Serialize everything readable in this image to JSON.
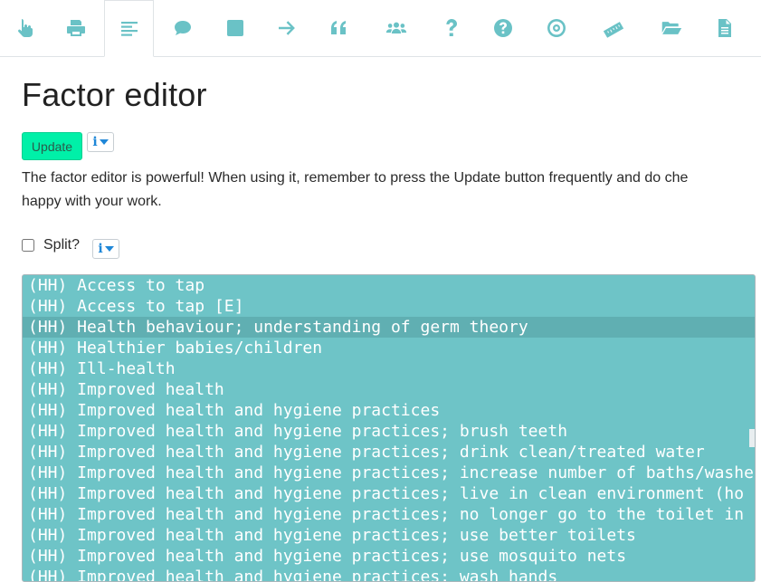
{
  "toolbar": {
    "items": [
      {
        "name": "hand-pointer-icon"
      },
      {
        "name": "print-icon"
      },
      {
        "name": "align-left-icon",
        "active": true
      },
      {
        "name": "comment-icon"
      },
      {
        "name": "square-icon"
      },
      {
        "name": "arrow-right-icon"
      },
      {
        "name": "quote-icon"
      },
      {
        "name": "users-icon"
      },
      {
        "name": "question-icon"
      },
      {
        "name": "question-circle-icon"
      },
      {
        "name": "bullseye-icon"
      },
      {
        "name": "ruler-icon"
      },
      {
        "name": "folder-open-icon"
      },
      {
        "name": "file-icon"
      }
    ],
    "accent_color": "#6ac2c6"
  },
  "page": {
    "title": "Factor editor",
    "update_label": "Update",
    "info_label": "i",
    "description_line1": "The factor editor is powerful! When using it, remember to press the Update button frequently and do che",
    "description_line2": "happy with your work.",
    "split_label": "Split?"
  },
  "factors": [
    "(HH) Access to tap",
    "(HH) Access to tap [E]",
    "(HH) Health behaviour; understanding of germ theory",
    "(HH) Healthier babies/children",
    "(HH) Ill-health",
    "(HH) Improved health",
    "(HH) Improved health and hygiene practices",
    "(HH) Improved health and hygiene practices; brush teeth",
    "(HH) Improved health and hygiene practices; drink clean/treated water",
    "(HH) Improved health and hygiene practices; increase number of baths/washe",
    "(HH) Improved health and hygiene practices; live in clean environment (ho",
    "(HH) Improved health and hygiene practices; no longer go to the toilet in",
    "(HH) Improved health and hygiene practices; use better toilets",
    "(HH) Improved health and hygiene practices; use mosquito nets",
    "(HH) Improved health and hygiene practices; wash hands"
  ],
  "highlighted_index": 2,
  "colors": {
    "list_bg": "#6ec4c7",
    "list_highlight": "#60afb2",
    "update_bg": "#00f0a8"
  }
}
